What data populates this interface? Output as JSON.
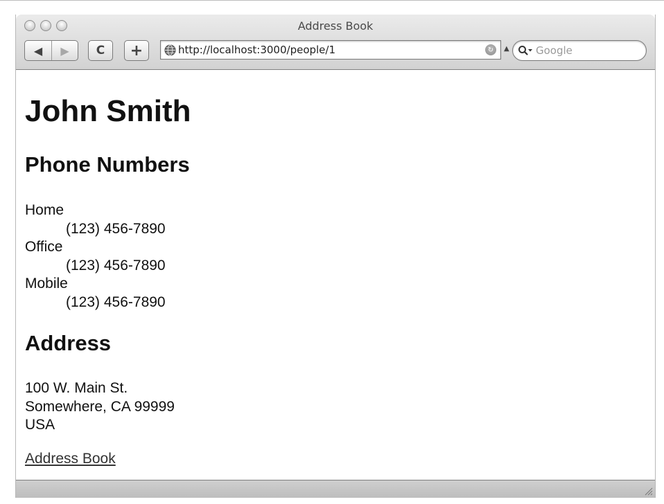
{
  "window": {
    "title": "Address Book"
  },
  "toolbar": {
    "back_icon": "back-arrow-icon",
    "forward_icon": "forward-arrow-icon",
    "reload_icon": "reload-icon",
    "add_icon": "add-bookmark-icon",
    "url": "http://localhost:3000/people/1",
    "search_placeholder": "Google"
  },
  "page": {
    "title": "John Smith",
    "phone_heading": "Phone Numbers",
    "phones": [
      {
        "label": "Home",
        "number": "(123) 456-7890"
      },
      {
        "label": "Office",
        "number": "(123) 456-7890"
      },
      {
        "label": "Mobile",
        "number": "(123) 456-7890"
      }
    ],
    "address_heading": "Address",
    "address": {
      "street": "100 W. Main St.",
      "city_line": "Somewhere, CA 99999",
      "country": "USA"
    },
    "link_text": "Address Book"
  },
  "colors": {
    "toolbar_top": "#ebebeb",
    "toolbar_bottom": "#d2d2d2",
    "link": "#333333",
    "text": "#111111"
  }
}
